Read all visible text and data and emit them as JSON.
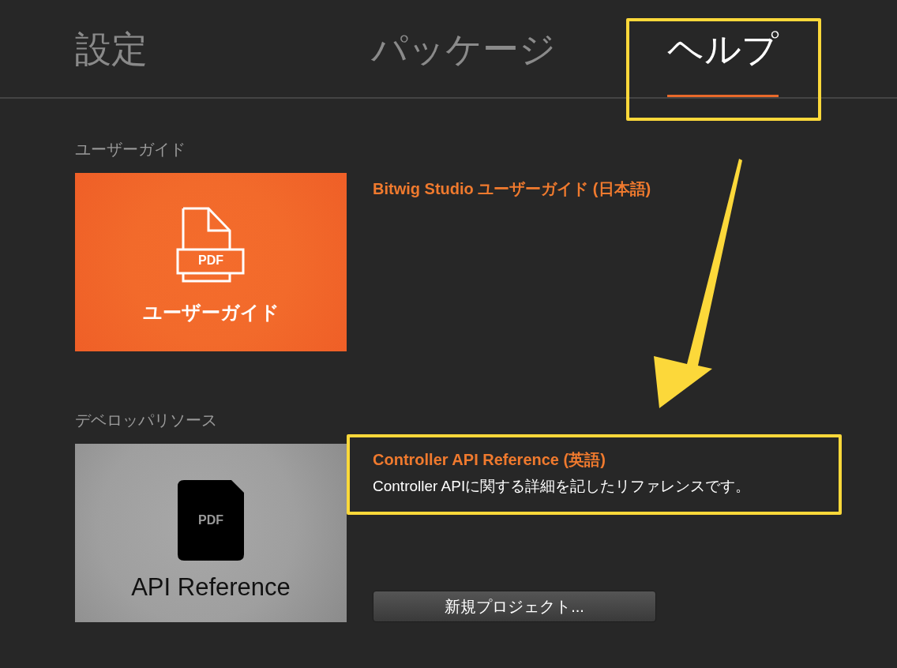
{
  "tabs": [
    {
      "label": "設定",
      "selected": false,
      "highlighted": false
    },
    {
      "label": "パッケージ",
      "selected": false,
      "highlighted": false
    },
    {
      "label": "ヘルプ",
      "selected": true,
      "highlighted": true
    }
  ],
  "sections": [
    {
      "heading": "ユーザーガイド",
      "thumbnail": {
        "kind": "orange",
        "icon_label": "PDF",
        "caption": "ユーザーガイド"
      },
      "links": [
        {
          "title": "Bitwig Studio ユーザーガイド (日本語)",
          "highlighted": false
        }
      ]
    },
    {
      "heading": "デベロッパリソース",
      "thumbnail": {
        "kind": "grey",
        "icon_label": "PDF",
        "caption": "API Reference"
      },
      "links": [
        {
          "title": "Controller API Reference (英語)",
          "description": "Controller APIに関する詳細を記したリファレンスです。",
          "highlighted": true
        }
      ],
      "button": {
        "label": "新規プロジェクト..."
      }
    }
  ],
  "arrow": {
    "kind": "pointer"
  }
}
